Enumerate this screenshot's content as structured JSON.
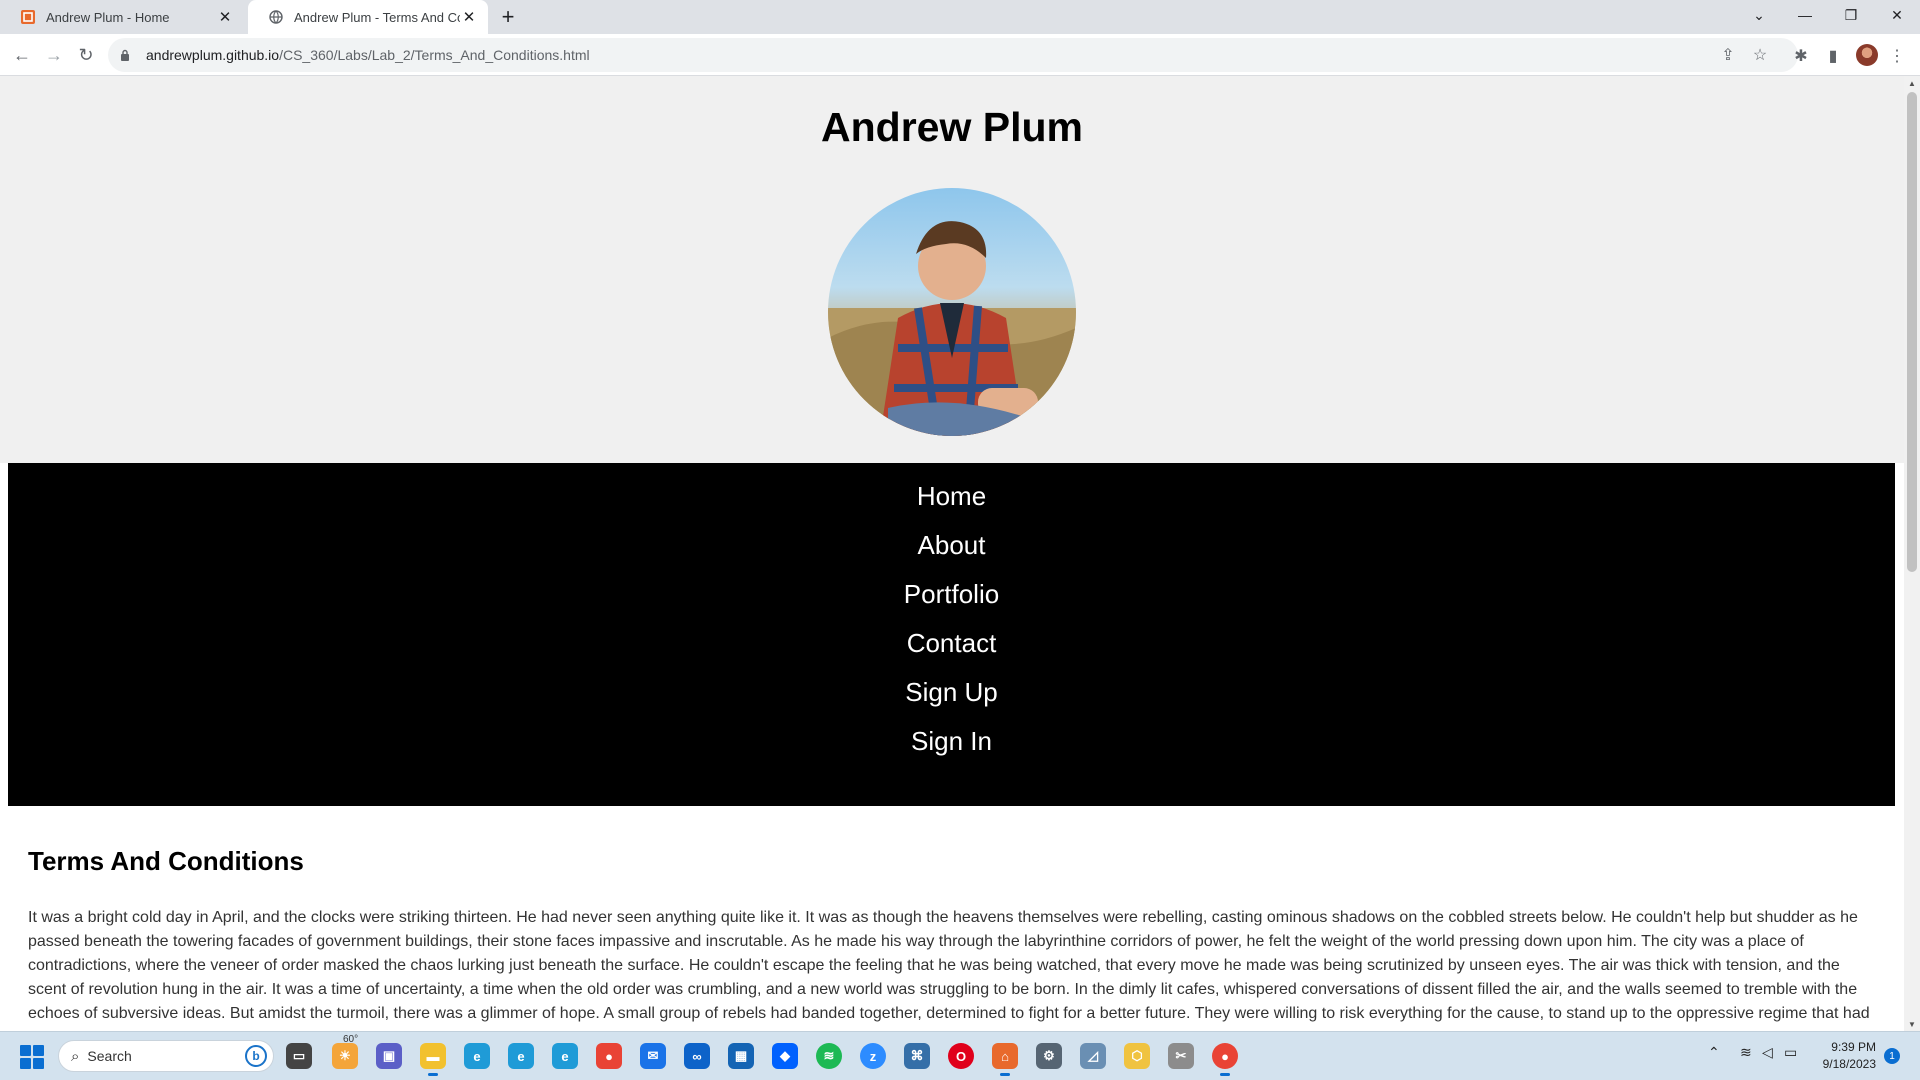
{
  "browser": {
    "tabs": [
      {
        "title": "Andrew Plum - Home",
        "active": false,
        "favicon": "html5-icon"
      },
      {
        "title": "Andrew Plum - Terms And Conditions",
        "active": true,
        "favicon": "globe-icon"
      }
    ],
    "new_tab": "+",
    "address": {
      "host": "andrewplum.github.io",
      "path": "/CS_360/Labs/Lab_2/Terms_And_Conditions.html"
    }
  },
  "page": {
    "title": "Andrew Plum",
    "nav": [
      "Home",
      "About",
      "Portfolio",
      "Contact",
      "Sign Up",
      "Sign In"
    ],
    "terms_heading": "Terms And Conditions",
    "terms_text": "It was a bright cold day in April, and the clocks were striking thirteen. He had never seen anything quite like it. It was as though the heavens themselves were rebelling, casting ominous shadows on the cobbled streets below. He couldn't help but shudder as he passed beneath the towering facades of government buildings, their stone faces impassive and inscrutable. As he made his way through the labyrinthine corridors of power, he felt the weight of the world pressing down upon him. The city was a place of contradictions, where the veneer of order masked the chaos lurking just beneath the surface. He couldn't escape the feeling that he was being watched, that every move he made was being scrutinized by unseen eyes. The air was thick with tension, and the scent of revolution hung in the air. It was a time of uncertainty, a time when the old order was crumbling, and a new world was struggling to be born. In the dimly lit cafes, whispered conversations of dissent filled the air, and the walls seemed to tremble with the echoes of subversive ideas. But amidst the turmoil, there was a glimmer of hope. A small group of rebels had banded together, determined to fight for a better future. They were willing to risk everything for the cause, to stand up to the oppressive regime that had"
  },
  "taskbar": {
    "search_placeholder": "Search",
    "weather": "60°",
    "time": "9:39 PM",
    "date": "9/18/2023",
    "notifications": "1"
  },
  "colors": {
    "nav_bg": "#000000",
    "header_bg": "#f0f0f0",
    "accent": "#0a6ed1"
  }
}
